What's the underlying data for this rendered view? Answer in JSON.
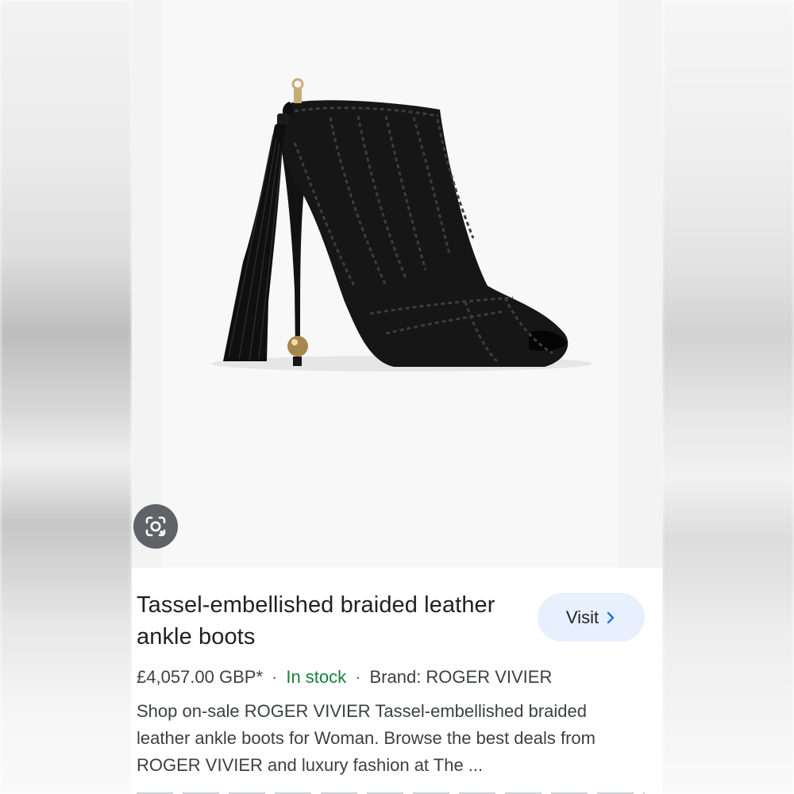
{
  "product": {
    "title": "Tassel-embellished braided leather ankle boots",
    "price": "£4,057.00 GBP*",
    "separator": "·",
    "availability": "In stock",
    "brand": "Brand: ROGER VIVIER",
    "description": "Shop on-sale ROGER VIVIER Tassel-embellished braided leather ankle boots for Woman. Browse the best deals from ROGER VIVIER and luxury fashion at The ..."
  },
  "actions": {
    "visit_label": "Visit"
  },
  "icons": {
    "lens": "google-lens-icon",
    "visit_chevron": "chevron-right-icon"
  },
  "colors": {
    "visit_bg": "#e8f0fe",
    "visit_chevron": "#1a73e8",
    "in_stock": "#188038",
    "lens_bg": "#5f6368"
  }
}
